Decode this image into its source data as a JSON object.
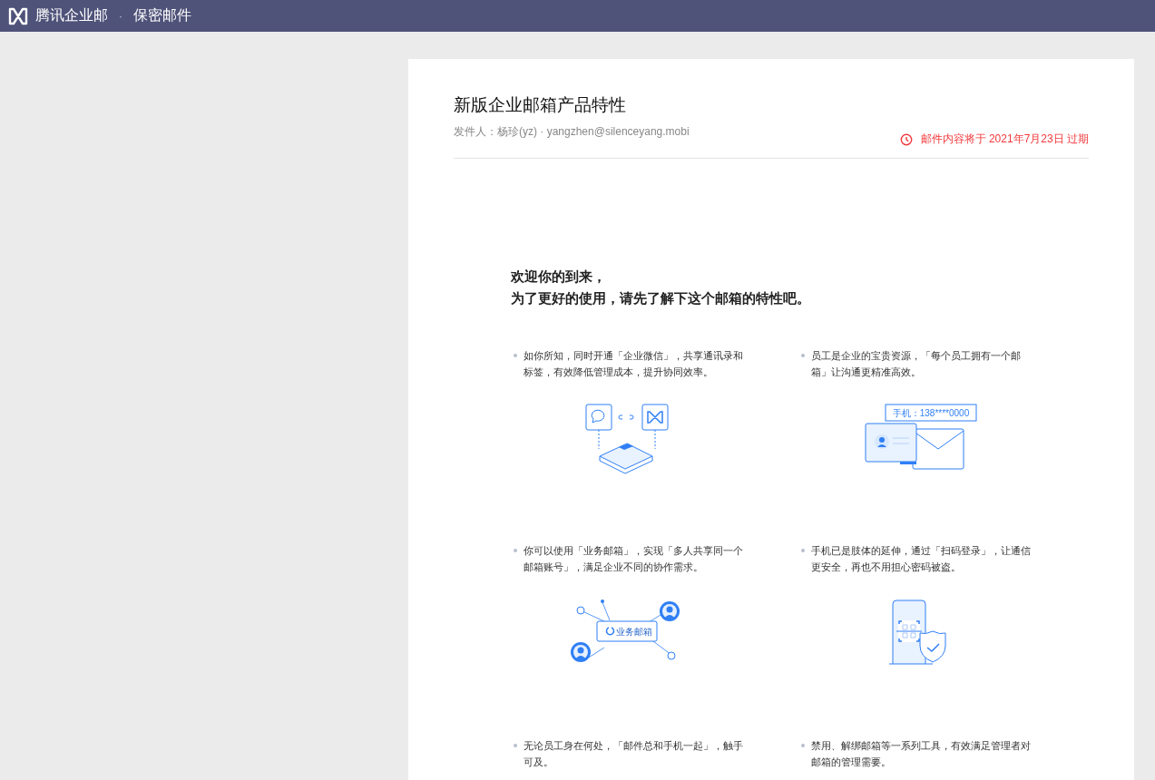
{
  "top_bar": {
    "brand": "腾讯企业邮",
    "separator": "·",
    "section": "保密邮件"
  },
  "mail": {
    "subject": "新版企业邮箱产品特性",
    "sender": "发件人：杨珍(yz) · yangzhen@silenceyang.mobi",
    "expiry": "邮件内容将于 2021年7月23日 过期",
    "intro": [
      "欢迎你的到来，",
      "为了更好的使用，请先了解下这个邮箱的特性吧。"
    ],
    "features": [
      {
        "text": "如你所知，同时开通「企业微信」，共享通讯录和标签，有效降低管理成本，提升协同效率。",
        "illustration": {
          "kind": "app-link"
        }
      },
      {
        "text": "员工是企业的宝贵资源，「每个员工拥有一个邮箱」让沟通更精准高效。",
        "illustration": {
          "kind": "contact-card",
          "label": "手机：138****0000"
        }
      },
      {
        "text": "你可以使用「业务邮箱」，实现「多人共享同一个邮箱账号」，满足企业不同的协作需求。",
        "illustration": {
          "kind": "shared-mailbox",
          "label": "业务邮箱"
        }
      },
      {
        "text": "手机已是肢体的延伸，通过「扫码登录」，让通信更安全，再也不用担心密码被盗。",
        "illustration": {
          "kind": "qr-login"
        }
      },
      {
        "text": "无论员工身在何处，「邮件总和手机一起」，触手可及。"
      },
      {
        "text": "禁用、解绑邮箱等一系列工具，有效满足管理者对邮箱的管理需要。"
      }
    ]
  }
}
